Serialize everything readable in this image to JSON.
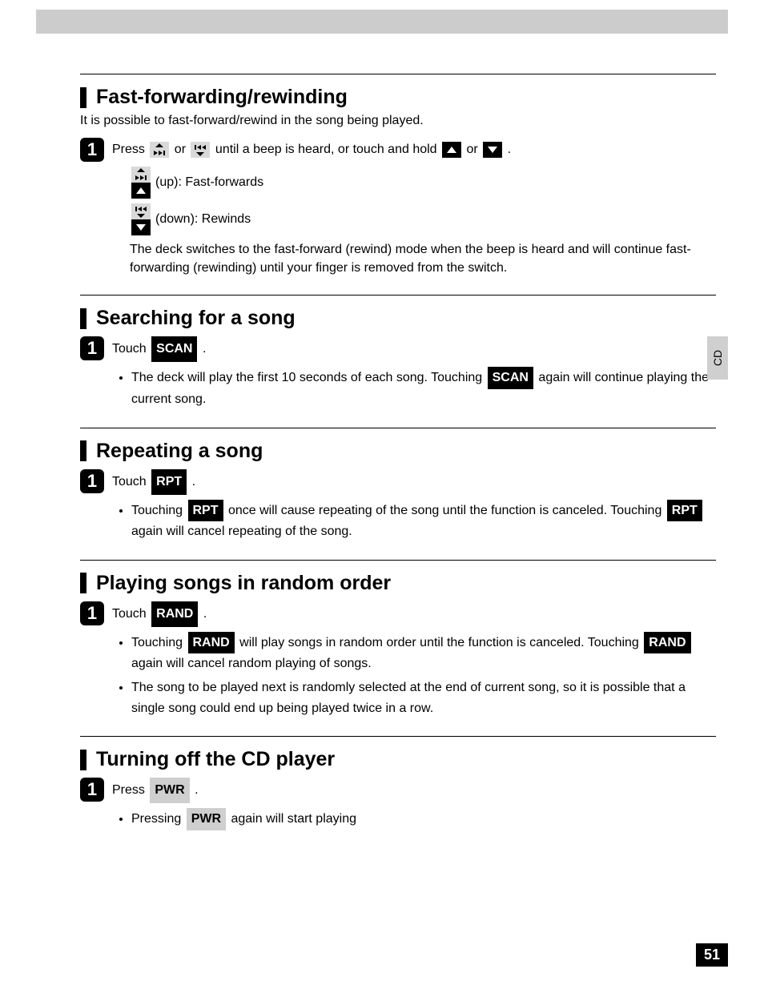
{
  "sideTab": "CD",
  "pageNumber": "51",
  "labels": {
    "scan": "SCAN",
    "rpt": "RPT",
    "rand": "RAND",
    "pwr": "PWR"
  },
  "sections": {
    "fastForward": {
      "title": "Fast-forwarding/rewinding",
      "intro": "It is possible to fast-forward/rewind in the song being played.",
      "stepNum": "1",
      "stepParts": {
        "a": "Press ",
        "b": " or ",
        "c": " until a beep is heard, or touch and hold ",
        "d": " or ",
        "e": "."
      },
      "upLabel": " (up): Fast-forwards",
      "downLabel": " (down): Rewinds",
      "note": "The deck switches to the fast-forward (rewind) mode when the beep is heard and will continue fast-forwarding (rewinding) until your finger is removed from the switch."
    },
    "searching": {
      "title": "Searching for a song",
      "stepNum": "1",
      "stepParts": {
        "a": "Touch ",
        "b": "."
      },
      "bullet1": {
        "a": "The deck will play the first 10 seconds of each song.  Touching ",
        "b": " again will continue playing the current song."
      }
    },
    "repeating": {
      "title": "Repeating a song",
      "stepNum": "1",
      "stepParts": {
        "a": "Touch ",
        "b": "."
      },
      "bullet1": {
        "a": "Touching ",
        "b": " once will cause repeating of the song until the function is canceled. Touching ",
        "c": " again will cancel repeating of the song."
      }
    },
    "random": {
      "title": "Playing songs in random order",
      "stepNum": "1",
      "stepParts": {
        "a": "Touch ",
        "b": "."
      },
      "bullet1": {
        "a": "Touching ",
        "b": " will play songs in random order until the function is canceled. Touching ",
        "c": " again will cancel random playing of songs."
      },
      "bullet2": "The song to be played next is randomly selected at the end of current song, so it is possible that a single song could end up being played twice in a row."
    },
    "turnOff": {
      "title": "Turning off the CD player",
      "stepNum": "1",
      "stepParts": {
        "a": "Press ",
        "b": "."
      },
      "bullet1": {
        "a": "Pressing ",
        "b": " again will start playing"
      }
    }
  }
}
